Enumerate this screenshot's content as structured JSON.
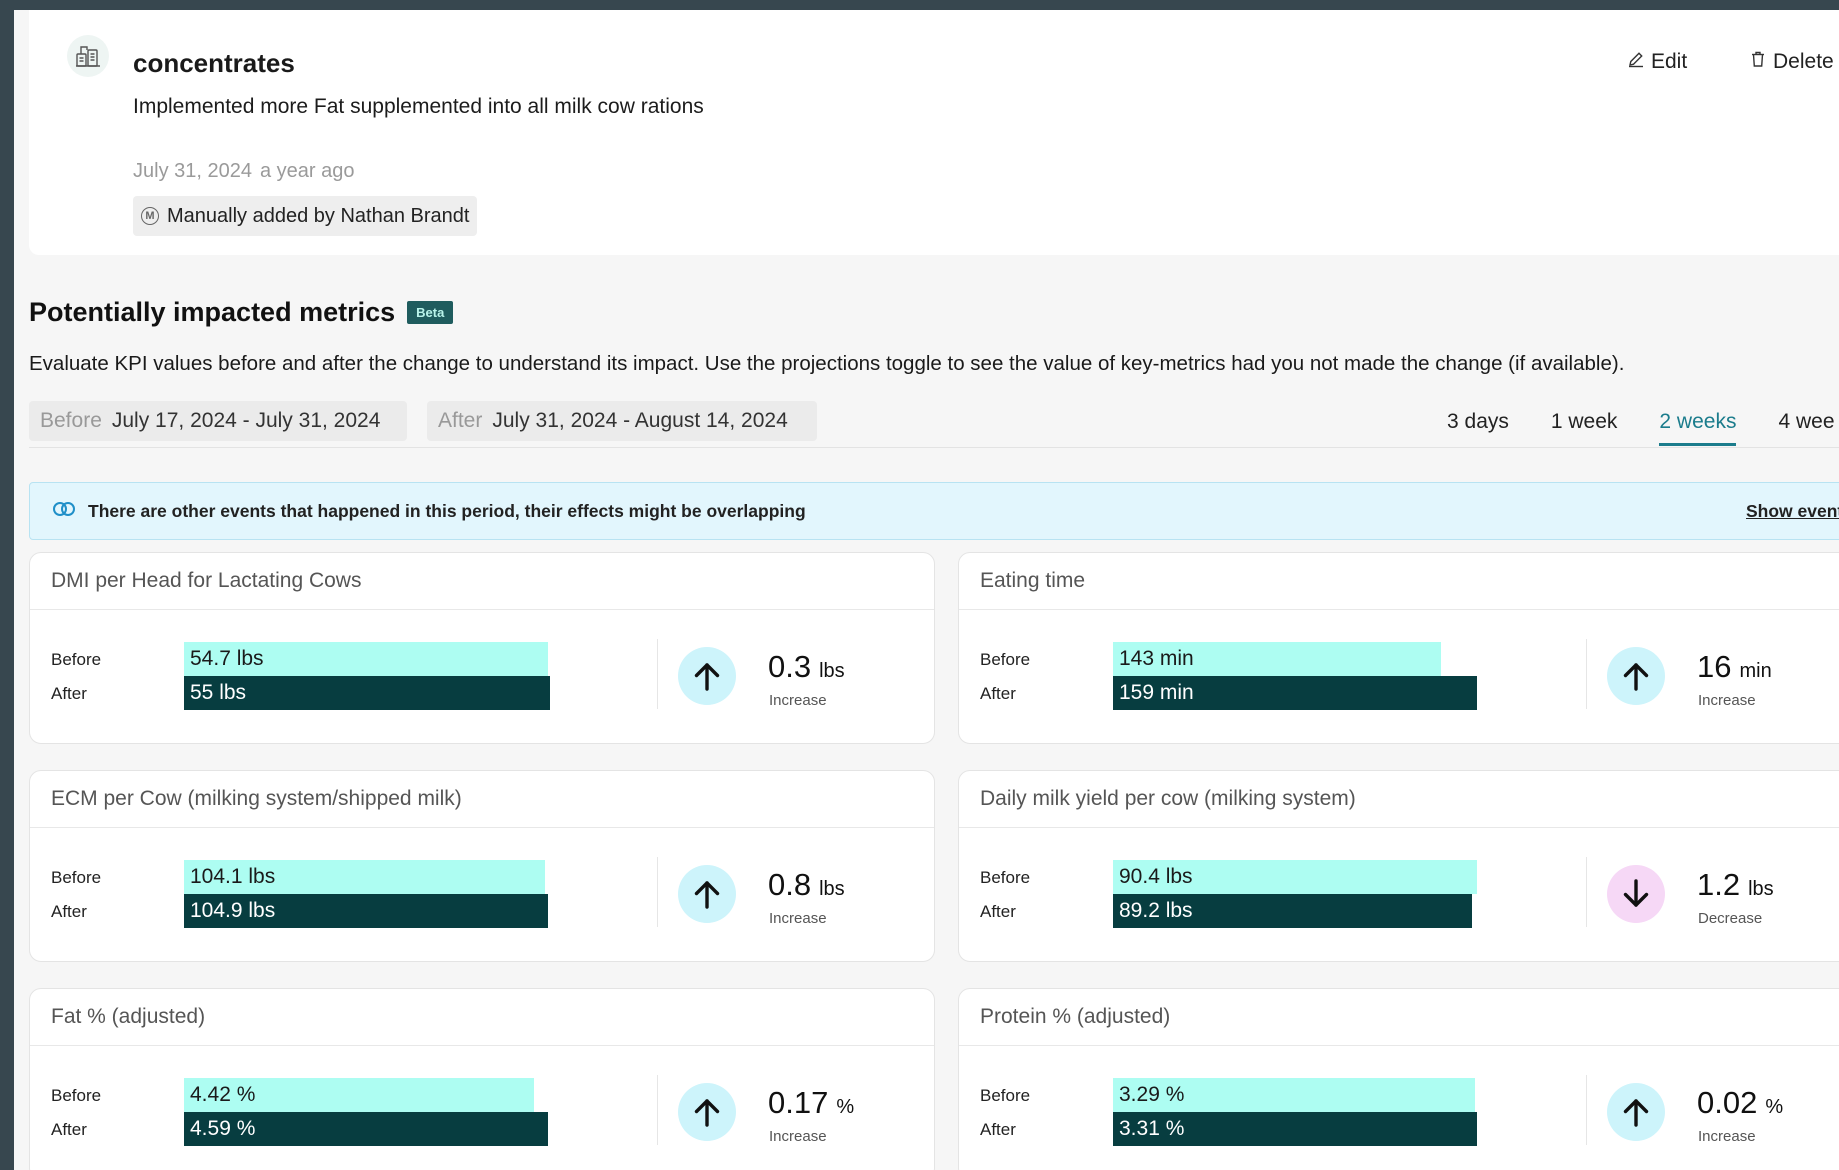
{
  "event": {
    "title": "concentrates",
    "description": "Implemented more Fat supplemented into all milk cow rations",
    "date": "July 31, 2024",
    "relative": "a year ago",
    "source": "Manually added by Nathan Brandt",
    "source_icon": "M",
    "edit_label": "Edit",
    "delete_label": "Delete"
  },
  "section": {
    "title": "Potentially impacted metrics",
    "badge": "Beta",
    "description": "Evaluate KPI values before and after the change to understand its impact. Use the projections toggle to see the value of key-metrics had you not made the change (if available)."
  },
  "periods": {
    "before_label": "Before",
    "before_range": "July 17, 2024 - July 31, 2024",
    "after_label": "After",
    "after_range": "July 31, 2024 - August 14, 2024"
  },
  "tabs": [
    "3 days",
    "1 week",
    "2 weeks",
    "4 wee"
  ],
  "active_tab": "2 weeks",
  "overlap": {
    "text": "There are other events that happened in this period, their effects might be overlapping",
    "link": "Show events"
  },
  "row_labels": {
    "before": "Before",
    "after": "After"
  },
  "metrics": [
    {
      "title": "DMI per Head for Lactating Cows",
      "before": "54.7 lbs",
      "after": "55 lbs",
      "before_fill": 0.852,
      "after_fill": 0.858,
      "change": "0.3",
      "unit": "lbs",
      "direction": "Increase",
      "arrow": "up"
    },
    {
      "title": "Eating time",
      "before": "143 min",
      "after": "159 min",
      "before_fill": 0.767,
      "after_fill": 0.853,
      "change": "16",
      "unit": "min",
      "direction": "Increase",
      "arrow": "up"
    },
    {
      "title": "ECM per Cow (milking system/shipped milk)",
      "before": "104.1 lbs",
      "after": "104.9 lbs",
      "before_fill": 0.845,
      "after_fill": 0.852,
      "change": "0.8",
      "unit": "lbs",
      "direction": "Increase",
      "arrow": "up"
    },
    {
      "title": "Daily milk yield per cow (milking system)",
      "before": "90.4 lbs",
      "after": "89.2 lbs",
      "before_fill": 0.852,
      "after_fill": 0.84,
      "change": "1.2",
      "unit": "lbs",
      "direction": "Decrease",
      "arrow": "down"
    },
    {
      "title": "Fat % (adjusted)",
      "before": "4.42 %",
      "after": "4.59 %",
      "before_fill": 0.82,
      "after_fill": 0.852,
      "change": "0.17",
      "unit": "%",
      "direction": "Increase",
      "arrow": "up"
    },
    {
      "title": "Protein % (adjusted)",
      "before": "3.29 %",
      "after": "3.31 %",
      "before_fill": 0.847,
      "after_fill": 0.852,
      "change": "0.02",
      "unit": "%",
      "direction": "Increase",
      "arrow": "up"
    }
  ],
  "colors": {
    "bar_before": "#adfdf2",
    "bar_after": "#073d40",
    "accent": "#1b7c8c",
    "arrow_up_bg": "#cdf4fb",
    "arrow_down_bg": "#f6d8f6"
  },
  "icons": {
    "event": "concentrates-icon",
    "edit": "pencil-icon",
    "delete": "trash-icon",
    "source": "manual-entry-icon",
    "overlap": "overlap-circles-icon",
    "increase": "arrow-up-icon",
    "decrease": "arrow-down-icon"
  }
}
